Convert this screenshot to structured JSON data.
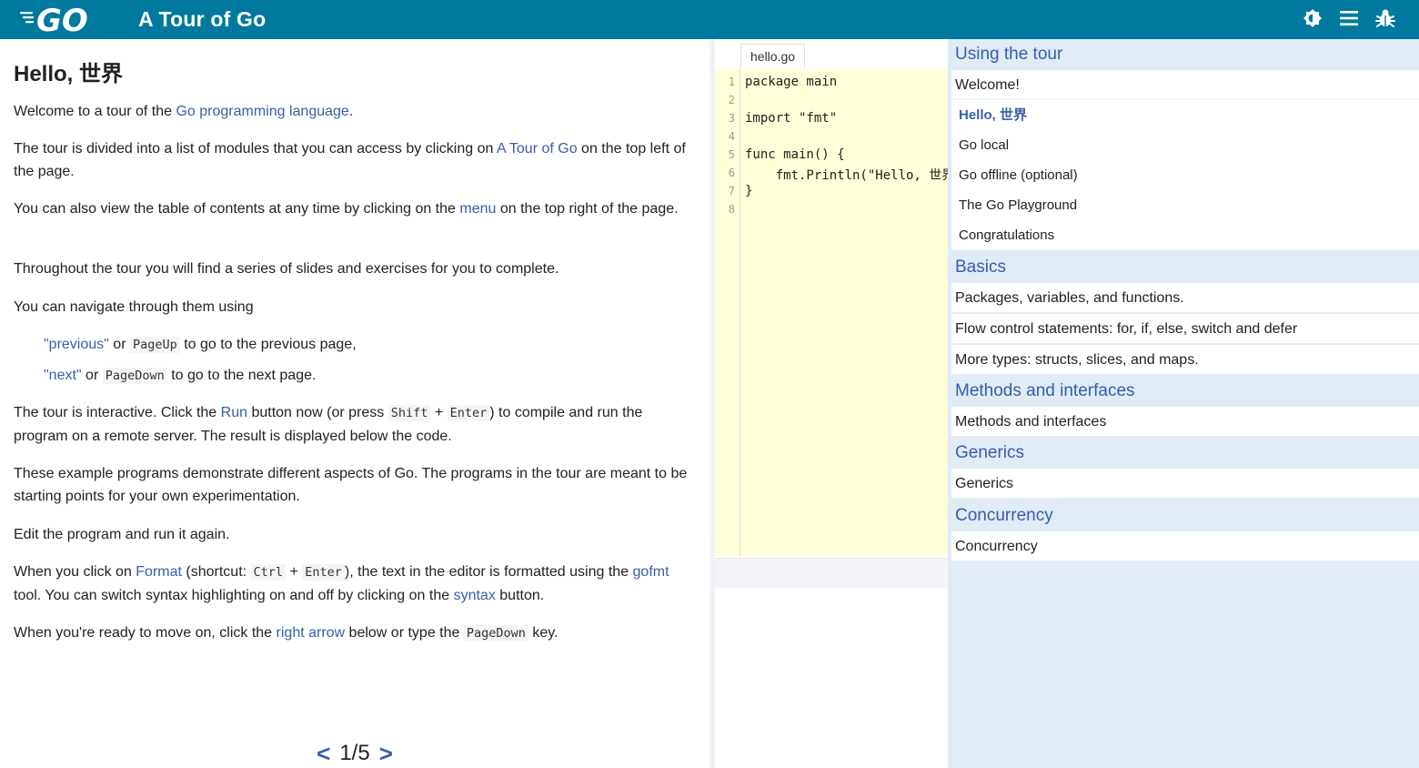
{
  "app": {
    "title": "A Tour of Go",
    "logo_text": "GO"
  },
  "toolbar": {
    "icons": [
      "brightness-icon",
      "menu-icon",
      "bug-icon"
    ]
  },
  "lesson": {
    "title": "Hello, 世界",
    "p1": {
      "a": "Welcome to a tour of the ",
      "link": "Go programming language",
      "b": "."
    },
    "p2": {
      "a": "The tour is divided into a list of modules that you can access by clicking on ",
      "link": "A Tour of Go",
      "b": " on the top left of the page."
    },
    "p3": {
      "a": "You can also view the table of contents at any time by clicking on the ",
      "link": "menu",
      "b": " on the top right of the page."
    },
    "p4": "Throughout the tour you will find a series of slides and exercises for you to complete.",
    "p5": "You can navigate through them using",
    "nav_prev": {
      "link": "\"previous\"",
      "a": " or ",
      "key": "PageUp",
      "b": " to go to the previous page,"
    },
    "nav_next": {
      "link": "\"next\"",
      "a": " or ",
      "key": "PageDown",
      "b": " to go to the next page."
    },
    "p6": {
      "a": "The tour is interactive. Click the ",
      "link": "Run",
      "b": " button now (or press ",
      "key1": "Shift",
      "plus": " + ",
      "key2": "Enter",
      "c": ") to compile and run the program on a remote server. The result is displayed below the code."
    },
    "p7": "These example programs demonstrate different aspects of Go. The programs in the tour are meant to be starting points for your own experimentation.",
    "p8": "Edit the program and run it again.",
    "p9": {
      "a": "When you click on ",
      "link1": "Format",
      "b": " (shortcut: ",
      "key1": "Ctrl",
      "plus": " + ",
      "key2": "Enter",
      "c": "), the text in the editor is formatted using the ",
      "link2": "gofmt",
      "d": " tool. You can switch syntax highlighting on and off by clicking on the ",
      "link3": "syntax",
      "e": " button."
    },
    "p10": {
      "a": "When you're ready to move on, click the ",
      "link": "right arrow",
      "b": " below or type the ",
      "key": "PageDown",
      "c": " key."
    }
  },
  "pager": {
    "prev": "<",
    "label": "1/5",
    "next": ">"
  },
  "editor": {
    "filename": "hello.go",
    "line_numbers": [
      "1",
      "2",
      "3",
      "4",
      "5",
      "6",
      "7",
      "8"
    ],
    "lines": [
      "package main",
      "",
      "import \"fmt\"",
      "",
      "func main() {",
      "\tfmt.Println(\"Hello, 世界\")",
      "}",
      ""
    ]
  },
  "toc": {
    "using_the_tour": "Using the tour",
    "welcome": "Welcome!",
    "pages": [
      "Hello, 世界",
      "Go local",
      "Go offline (optional)",
      "The Go Playground",
      "Congratulations"
    ],
    "basics": "Basics",
    "basics_lessons": [
      "Packages, variables, and functions.",
      "Flow control statements: for, if, else, switch and defer",
      "More types: structs, slices, and maps."
    ],
    "methods": "Methods and interfaces",
    "methods_lesson": "Methods and interfaces",
    "generics": "Generics",
    "generics_lesson": "Generics",
    "concurrency": "Concurrency",
    "concurrency_lesson": "Concurrency"
  },
  "colors": {
    "header": "#00799f",
    "link": "#375eab",
    "editor_bg": "#ffffd8",
    "toc_bg": "#e0ebf5"
  }
}
